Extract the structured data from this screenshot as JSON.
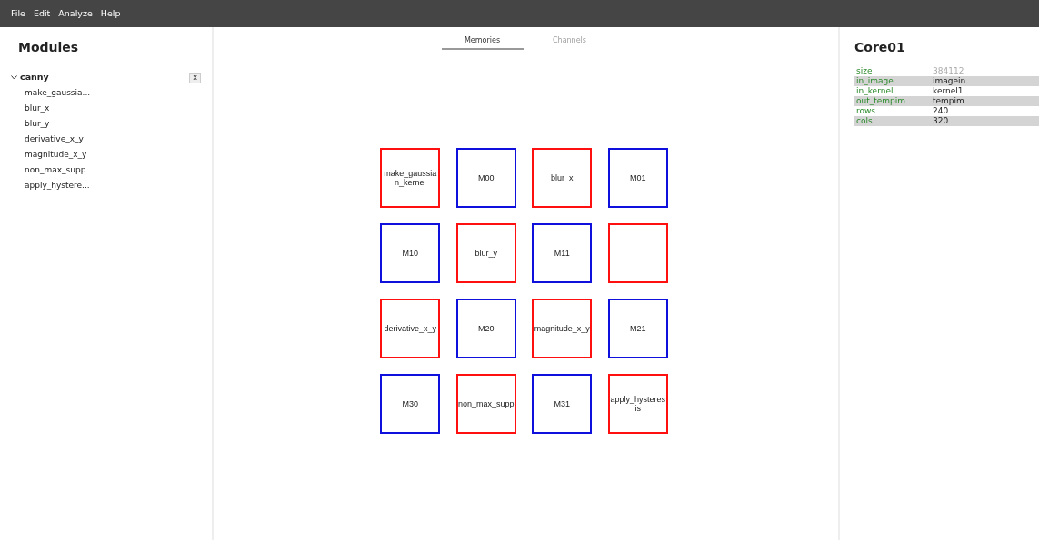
{
  "menu": [
    "File",
    "Edit",
    "Analyze",
    "Help"
  ],
  "modules": {
    "title": "Modules",
    "groups": [
      {
        "label": "canny",
        "expanded": true,
        "close": "x",
        "children": [
          {
            "label": "make_gaussia..."
          },
          {
            "label": "blur_x"
          },
          {
            "label": "blur_y"
          },
          {
            "label": "derivative_x_y"
          },
          {
            "label": "magnitude_x_y"
          },
          {
            "label": "non_max_supp"
          },
          {
            "label": "apply_hystere..."
          }
        ]
      }
    ]
  },
  "tabs": [
    {
      "label": "Memories",
      "selected": true
    },
    {
      "label": "Channels",
      "selected": false
    }
  ],
  "grid": [
    {
      "kind": "core",
      "label": "make_gaussian_kernel"
    },
    {
      "kind": "memory",
      "label": "M00"
    },
    {
      "kind": "core",
      "label": "blur_x"
    },
    {
      "kind": "memory",
      "label": "M01"
    },
    {
      "kind": "memory",
      "label": "M10"
    },
    {
      "kind": "core",
      "label": "blur_y"
    },
    {
      "kind": "memory",
      "label": "M11"
    },
    {
      "kind": "core"
    },
    {
      "kind": "core",
      "label": "derivative_x_y"
    },
    {
      "kind": "memory",
      "label": "M20"
    },
    {
      "kind": "core",
      "label": "magnitude_x_y"
    },
    {
      "kind": "memory",
      "label": "M21"
    },
    {
      "kind": "memory",
      "label": "M30"
    },
    {
      "kind": "core",
      "label": "non_max_supp"
    },
    {
      "kind": "memory",
      "label": "M31"
    },
    {
      "kind": "core",
      "label": "apply_hysteresis"
    }
  ],
  "inspector": {
    "title": "Core01",
    "properties": [
      {
        "key": "size",
        "value": "384112",
        "editable": false
      },
      {
        "key": "in_image",
        "value": "imagein",
        "editable": true
      },
      {
        "key": "in_kernel",
        "value": "kernel1",
        "editable": true
      },
      {
        "key": "out_tempim",
        "value": "tempim",
        "editable": true
      },
      {
        "key": "rows",
        "value": "240",
        "editable": true
      },
      {
        "key": "cols",
        "value": "320",
        "editable": true
      }
    ]
  }
}
